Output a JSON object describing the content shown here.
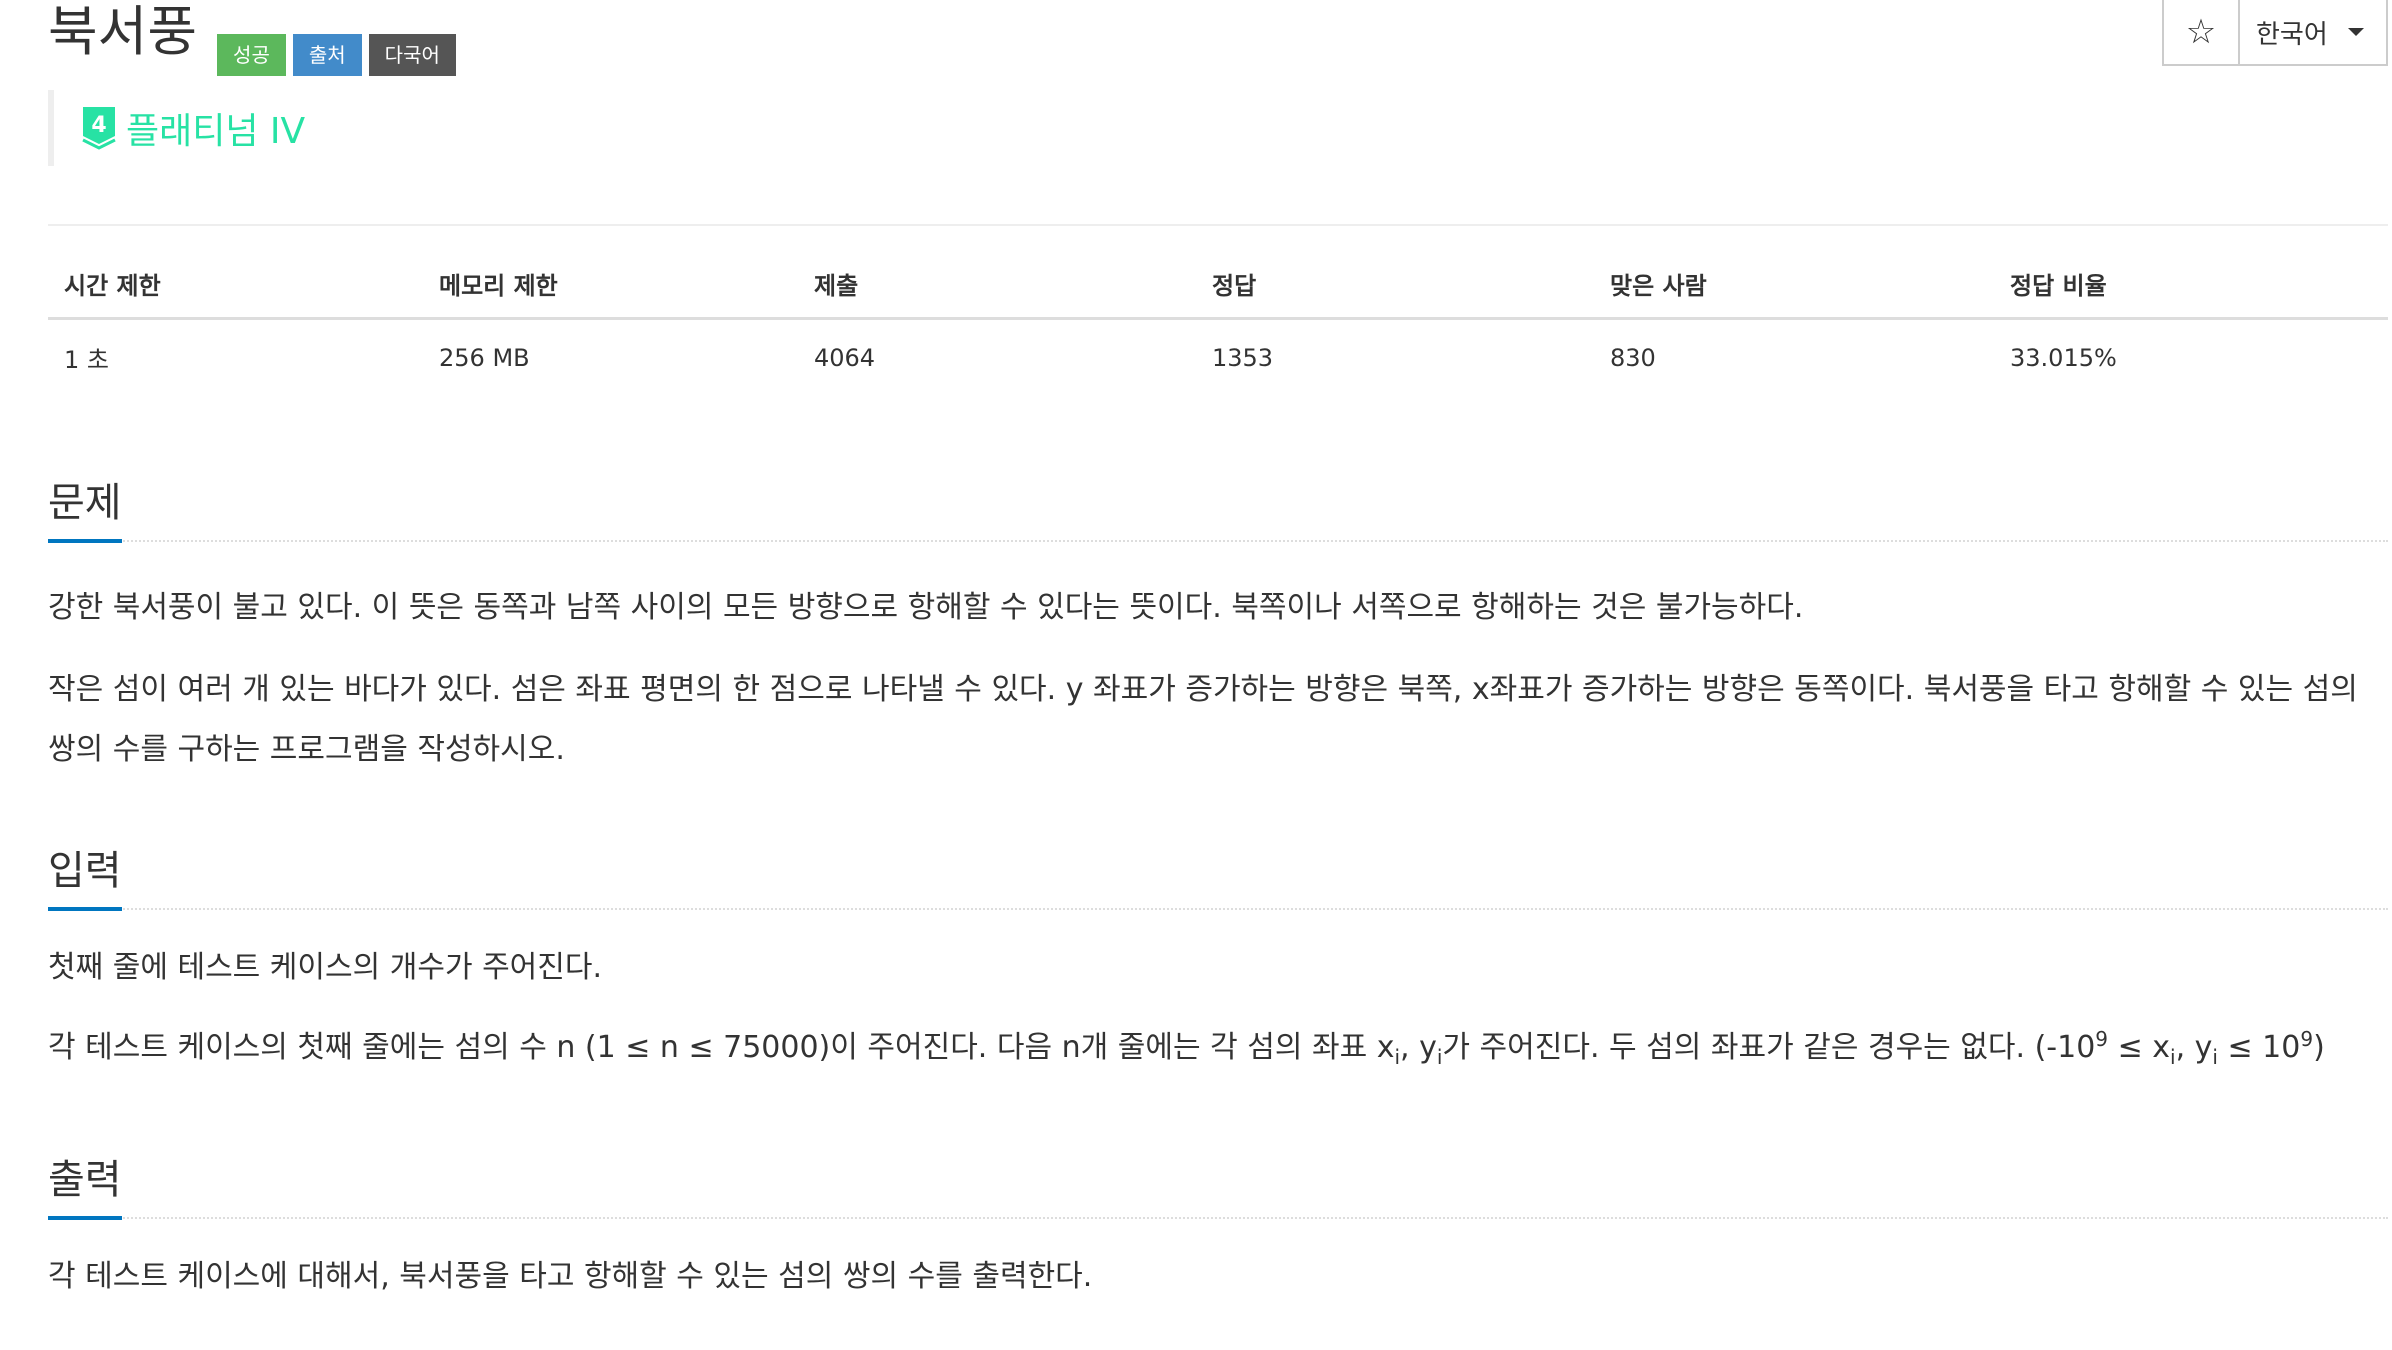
{
  "problem": {
    "title": "북서풍",
    "badges": {
      "success": "성공",
      "source": "출처",
      "multilang": "다국어"
    },
    "tier": {
      "icon_number": "4",
      "label": "플래티넘 IV",
      "color": "#27e2a4"
    }
  },
  "top_buttons": {
    "star": "☆",
    "language": "한국어"
  },
  "info_table": {
    "headers": [
      "시간 제한",
      "메모리 제한",
      "제출",
      "정답",
      "맞은 사람",
      "정답 비율"
    ],
    "values": [
      "1 초",
      "256 MB",
      "4064",
      "1353",
      "830",
      "33.015%"
    ]
  },
  "sections": {
    "description": {
      "title": "문제",
      "paragraph1": "강한 북서풍이 불고 있다. 이 뜻은 동쪽과 남쪽 사이의 모든 방향으로 항해할 수 있다는 뜻이다. 북쪽이나 서쪽으로 항해하는 것은 불가능하다.",
      "paragraph2": "작은 섬이 여러 개 있는 바다가 있다. 섬은 좌표 평면의 한 점으로 나타낼 수 있다. y 좌표가 증가하는 방향은 북쪽, x좌표가 증가하는 방향은 동쪽이다. 북서풍을 타고 항해할 수 있는 섬의 쌍의 수를 구하는 프로그램을 작성하시오."
    },
    "input": {
      "title": "입력",
      "paragraph1": "첫째 줄에 테스트 케이스의 개수가 주어진다.",
      "paragraph2_a": "각 테스트 케이스의 첫째 줄에는 섬의 수 n (1 ≤ n ≤ 75000)이 주어진다. 다음 n개 줄에는 각 섬의 좌표 x",
      "paragraph2_sub1": "i",
      "paragraph2_b": ", y",
      "paragraph2_sub2": "i",
      "paragraph2_c": "가 주어진다. 두 섬의 좌표가 같은 경우는 없다. (-10",
      "paragraph2_sup1": "9",
      "paragraph2_d": " ≤ x",
      "paragraph2_sub3": "i",
      "paragraph2_e": ", y",
      "paragraph2_sub4": "i",
      "paragraph2_f": " ≤ 10",
      "paragraph2_sup2": "9",
      "paragraph2_g": ")"
    },
    "output": {
      "title": "출력",
      "paragraph1": "각 테스트 케이스에 대해서, 북서풍을 타고 항해할 수 있는 섬의 쌍의 수를 출력한다."
    }
  },
  "colors": {
    "badge_success": "#5cb85c",
    "badge_source": "#428bca",
    "badge_multilang": "#555555",
    "section_underline": "#0076c0"
  }
}
